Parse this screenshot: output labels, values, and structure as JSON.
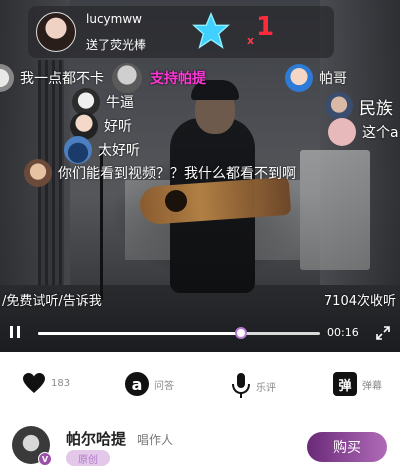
{
  "gift": {
    "username": "lucymww",
    "message": "送了荧光棒",
    "multiplier": "x",
    "count": "1",
    "icon": "star-glowstick-icon",
    "count_color": "#ff2a3a"
  },
  "danmaku": [
    {
      "text": "我一点都不卡"
    },
    {
      "text": "支持帕提"
    },
    {
      "text": "帕哥"
    },
    {
      "text": "民族"
    },
    {
      "text": "牛逼"
    },
    {
      "text": "好听"
    },
    {
      "text": "这个a"
    },
    {
      "text": "太好听"
    },
    {
      "text": "你们能看到视频？？我什么都看不到啊"
    }
  ],
  "video": {
    "free_trial_text": "/免费试听/告诉我",
    "play_count": "7104次收听",
    "elapsed": "00:16",
    "progress": 0.72
  },
  "actions": {
    "like_count": "183",
    "qa_label": "问答",
    "music_review_label": "乐评",
    "danmaku_icon_label": "弹",
    "danmaku_label": "弹幕"
  },
  "artist": {
    "name": "帕尔哈提",
    "role": "唱作人",
    "tag": "原创",
    "buy_label": "购买",
    "accent": "#9b4fa8"
  }
}
